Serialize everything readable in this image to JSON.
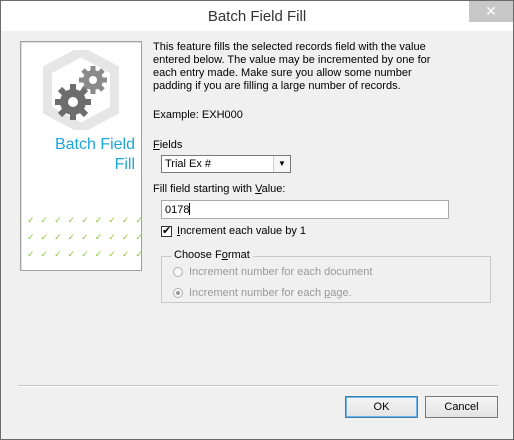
{
  "window": {
    "title": "Batch Field Fill",
    "close_glyph": "✕"
  },
  "side_panel": {
    "title_line1": "Batch Field",
    "title_line2": "Fill",
    "logo_icon": "gears-icon",
    "accent_color": "#1ca6d8",
    "check_color": "#8dc63f"
  },
  "description": "This feature fills the selected records field with the value entered below. The value may be incremented by one for each entry made. Make sure you allow some number padding if you are filling a large number of records.",
  "example": "Example: EXH000",
  "fields": {
    "label_mnemonic": "F",
    "label_rest": "ields",
    "selected": "Trial Ex #"
  },
  "fill": {
    "label_pre": "Fill field starting with ",
    "label_mnemonic": "V",
    "label_post": "alue:",
    "value": "0178"
  },
  "increment": {
    "label_mnemonic": "I",
    "label_rest": "ncrement each value by 1",
    "checked": true
  },
  "format": {
    "legend_pre": "Choose F",
    "legend_mnemonic": "o",
    "legend_post": "rmat",
    "option1": "Increment number for each document",
    "option2_pre": "Increment number for each ",
    "option2_mnemonic": "p",
    "option2_post": "age.",
    "selected_option": 2,
    "enabled": false
  },
  "buttons": {
    "ok": "OK",
    "cancel": "Cancel"
  }
}
